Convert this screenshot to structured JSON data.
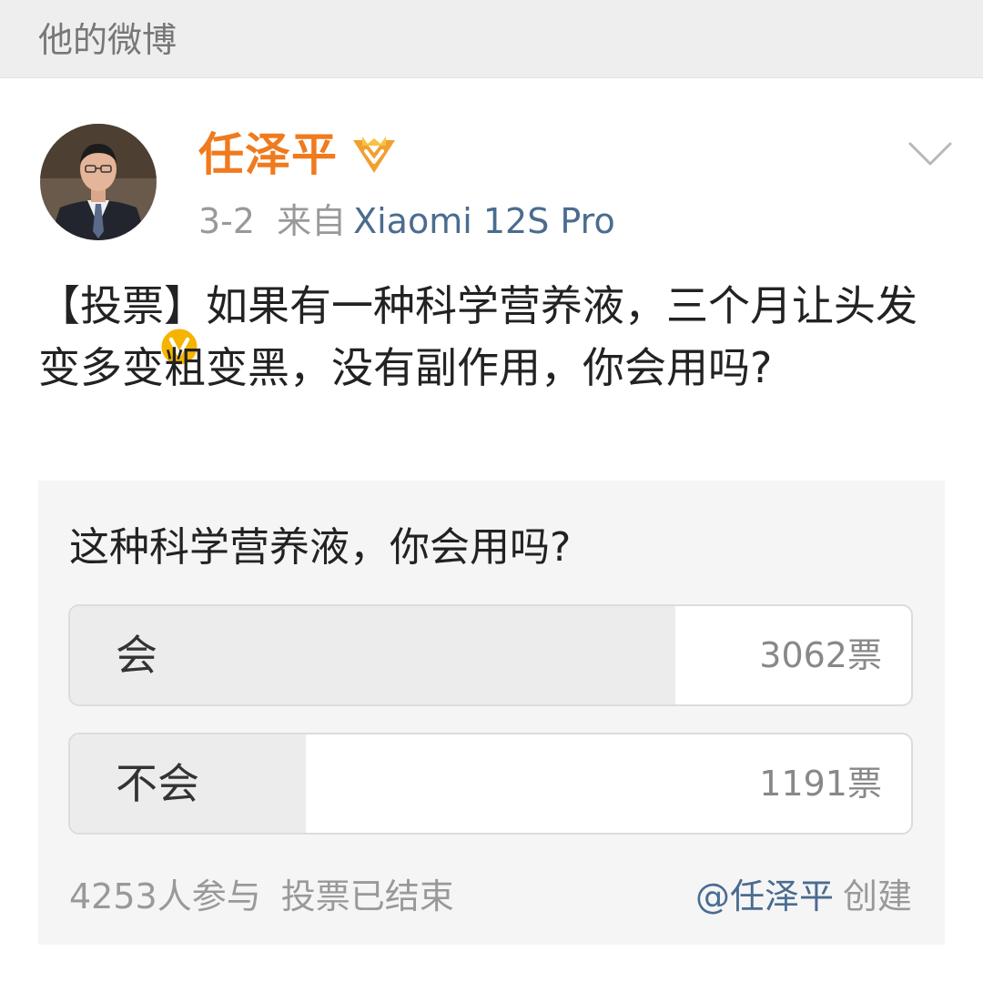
{
  "header": {
    "title": "他的微博"
  },
  "post": {
    "author": "任泽平",
    "date": "3-2",
    "from_label": "来自",
    "device": "Xiaomi 12S Pro",
    "text": "【投票】如果有一种科学营养液，三个月让头发变多变粗变黑，没有副作用，你会用吗?"
  },
  "poll": {
    "question": "这种科学营养液，你会用吗?",
    "options": [
      {
        "label": "会",
        "count_text": "3062票",
        "votes": 3062,
        "share": 0.72
      },
      {
        "label": "不会",
        "count_text": "1191票",
        "votes": 1191,
        "share": 0.28
      }
    ],
    "participants": "4253人参与",
    "status": "投票已结束",
    "creator": "@任泽平",
    "created_label": "创建"
  },
  "colors": {
    "author_name": "#f07a1e",
    "link_blue": "#4a6c8f",
    "badge_gold": "#f5b400",
    "vip_orange": "#f0a030",
    "poll_bg": "#f5f5f5",
    "poll_fill": "#ececec"
  },
  "icons": {
    "verified": "verified-v-icon",
    "vip": "vip-crown-icon",
    "more": "chevron-down-icon"
  }
}
